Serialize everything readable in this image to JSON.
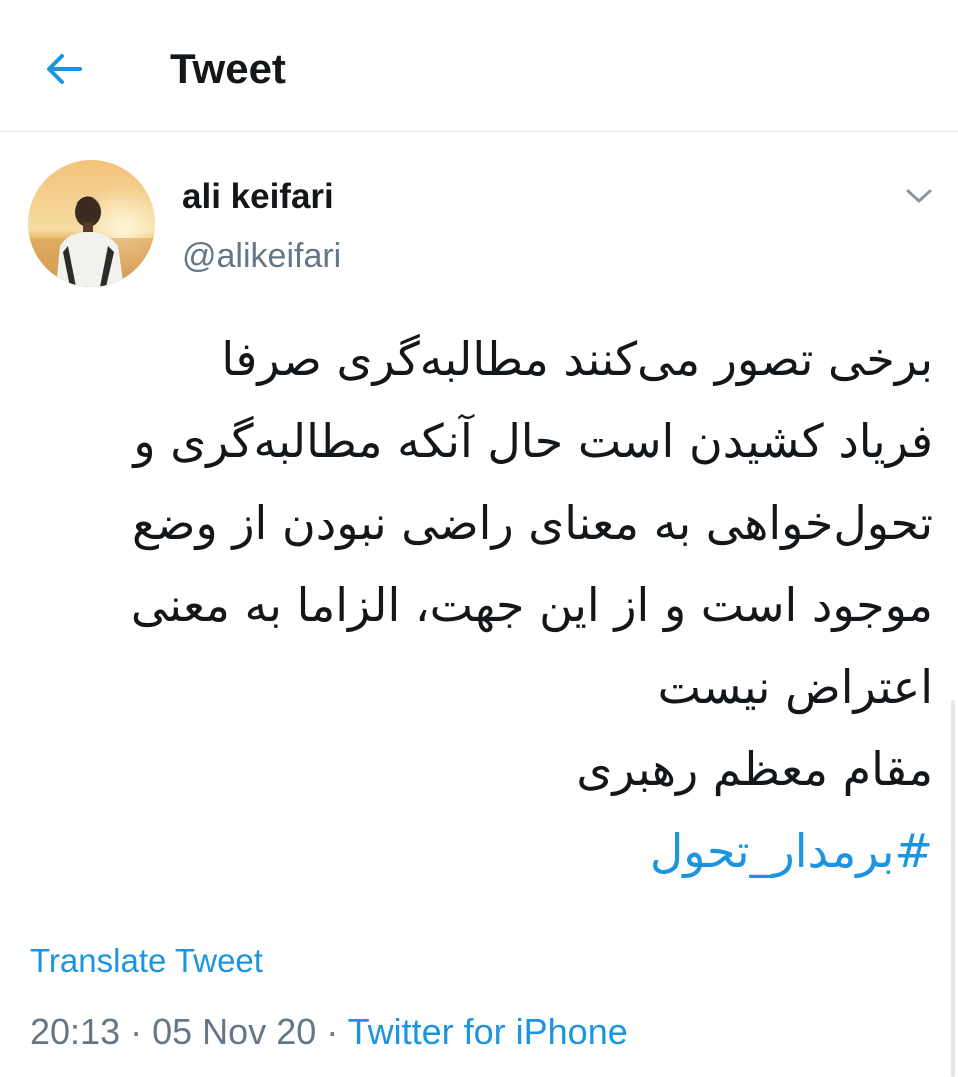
{
  "header": {
    "title": "Tweet",
    "back_icon": "arrow-left-icon"
  },
  "author": {
    "display_name": "ali keifari",
    "handle": "@alikeifari",
    "avatar_icon": "profile-photo"
  },
  "tweet": {
    "lines": [
      "برخی تصور می‌کنند مطالبه‌گری صرفا",
      "فریاد کشیدن است حال آنکه مطالبه‌گری و",
      "تحول‌خواهی به معنای راضی نبودن از وضع",
      "موجود است و از این جهت، الزاما به معنی",
      "اعتراض نیست",
      "مقام معظم رهبری"
    ],
    "hashtag": "#برمدار_تحول",
    "translate_label": "Translate Tweet"
  },
  "meta": {
    "time": "20:13",
    "separator": "·",
    "date": "05 Nov 20",
    "source": "Twitter for iPhone"
  },
  "colors": {
    "accent": "#1b95e0",
    "text": "#14171a",
    "secondary": "#657786",
    "divider": "#e6ecf0"
  }
}
